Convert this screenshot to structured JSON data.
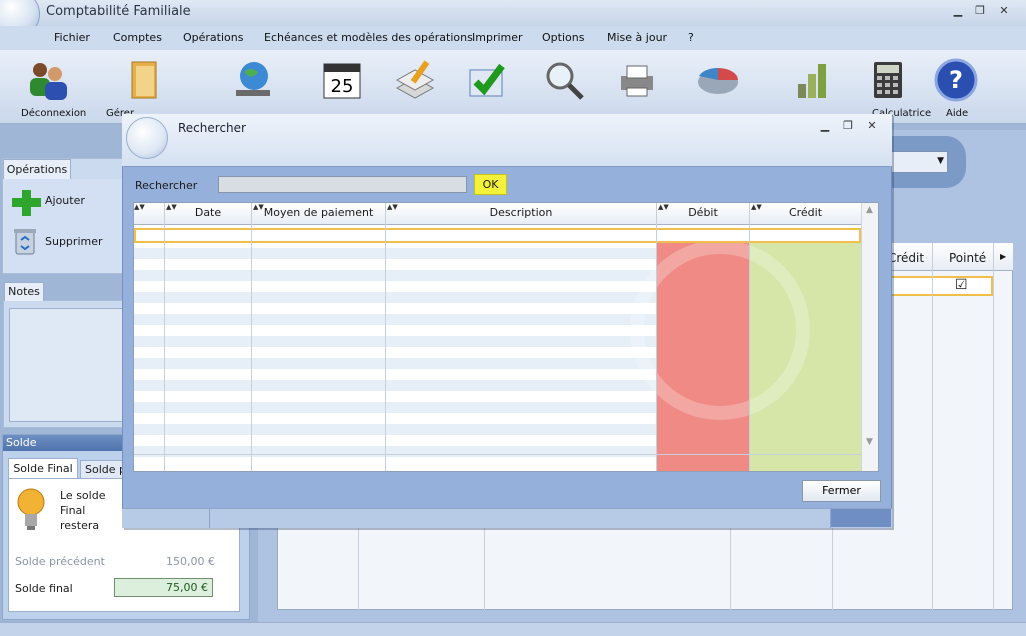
{
  "app": {
    "title": "Comptabilité Familiale",
    "minimize": "▁",
    "restore": "❐",
    "close": "✕"
  },
  "menu": [
    "Fichier",
    "Comptes",
    "Opérations",
    "Echéances et modèles des opérations",
    "Imprimer",
    "Options",
    "Mise à jour",
    "?"
  ],
  "toolbar": {
    "disconnect": "Déconnexion",
    "manage": "Gérer",
    "calculator": "Calculatrice",
    "help": "Aide",
    "calendar_day": "25"
  },
  "left": {
    "ops_tab": "Opérations",
    "add": "Ajouter",
    "delete": "Supprimer",
    "notes_tab": "Notes",
    "solde_header": "Solde",
    "solde_tab1": "Solde Final",
    "solde_tab2": "Solde pointé",
    "solde_desc": "Le solde Final restera après les opérations.",
    "prev_label": "Solde précédent",
    "prev_value": "150,00 €",
    "final_label": "Solde final",
    "final_value": "75,00 €"
  },
  "background_grid": {
    "col_credit": "Crédit",
    "col_pointe": "Pointé",
    "check": "☑"
  },
  "dialog": {
    "title": "Rechercher",
    "minimize": "▁",
    "restore": "❐",
    "close": "✕",
    "search_label": "Rechercher",
    "search_value": "",
    "ok": "OK",
    "columns": [
      "Date",
      "Moyen de paiement",
      "Description",
      "Débit",
      "Crédit"
    ],
    "close_button": "Fermer"
  },
  "colors": {
    "debit": "#ef8a85",
    "credit": "#d5e6a8",
    "ok_highlight": "#f4f13a"
  }
}
